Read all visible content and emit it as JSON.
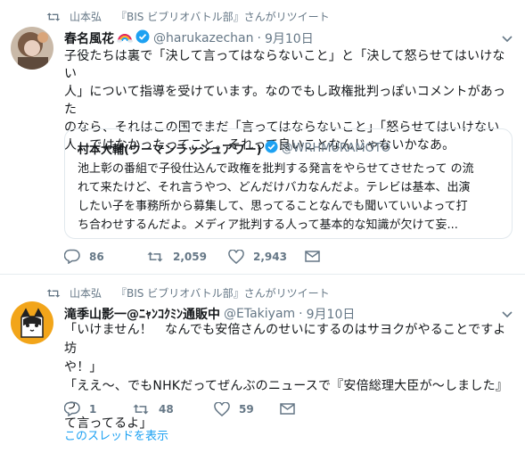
{
  "colors": {
    "accent": "#1da1f2",
    "muted": "#657786",
    "verified": "#1da1f2"
  },
  "tweets": [
    {
      "retweeter": "山本弘",
      "retweet_suffix": "『BIS ビブリオバトル部』さんがリツイート",
      "name": "春名風花",
      "name_emoji": "rainbow-emoji",
      "handle": "@harukazechan",
      "dot": "·",
      "time": "9月10日",
      "text_lines": [
        "子役たちは裏で「決して言ってはならないこと」と「決して怒らせてはいけない",
        "人」について指導を受けています。なのでもし政権批判っぽいコメントがあった",
        "のなら、それはこの国でまだ「言ってはならないこと」「怒らせてはいけない",
        "人」ではなかったってこと。それって良いことなんじゃないかなあ。"
      ],
      "quote": {
        "name": "村本大輔(ウーマンラッシュアワー)",
        "handle": "@WRHMURAMOTO",
        "text_lines": [
          "池上彰の番組で子役仕込んで政権を批判する発言をやらせてさせたって の流",
          "れて来たけど、それ言うやつ、どんだけバカなんだよ。テレビは基本、出演",
          "したい子を事務所から募集して、思ってることなんでも聞いていいよって打",
          "ち合わせするんだよ。メディア批判する人って基本的な知識が欠けて妄..."
        ]
      },
      "replies": "86",
      "retweets": "2,059",
      "likes": "2,943"
    },
    {
      "retweeter": "山本弘",
      "retweet_suffix": "『BIS ビブリオバトル部』さんがリツイート",
      "name": "滝季山影一@ﾆｬﾝｺｸﾐﾝ通販中",
      "handle": "@ETakiyam",
      "dot": "·",
      "time": "9月10日",
      "text_lines": [
        "「いけません！　なんでも安倍さんのせいにするのはサヨクがやることですよ坊",
        "や！」",
        "「ええ～、でもNHKだってぜんぶのニュースで『安倍総理大臣が～しました』っ",
        "て言ってるよ」"
      ],
      "replies": "1",
      "retweets": "48",
      "likes": "59",
      "show_thread": "このスレッドを表示"
    }
  ]
}
